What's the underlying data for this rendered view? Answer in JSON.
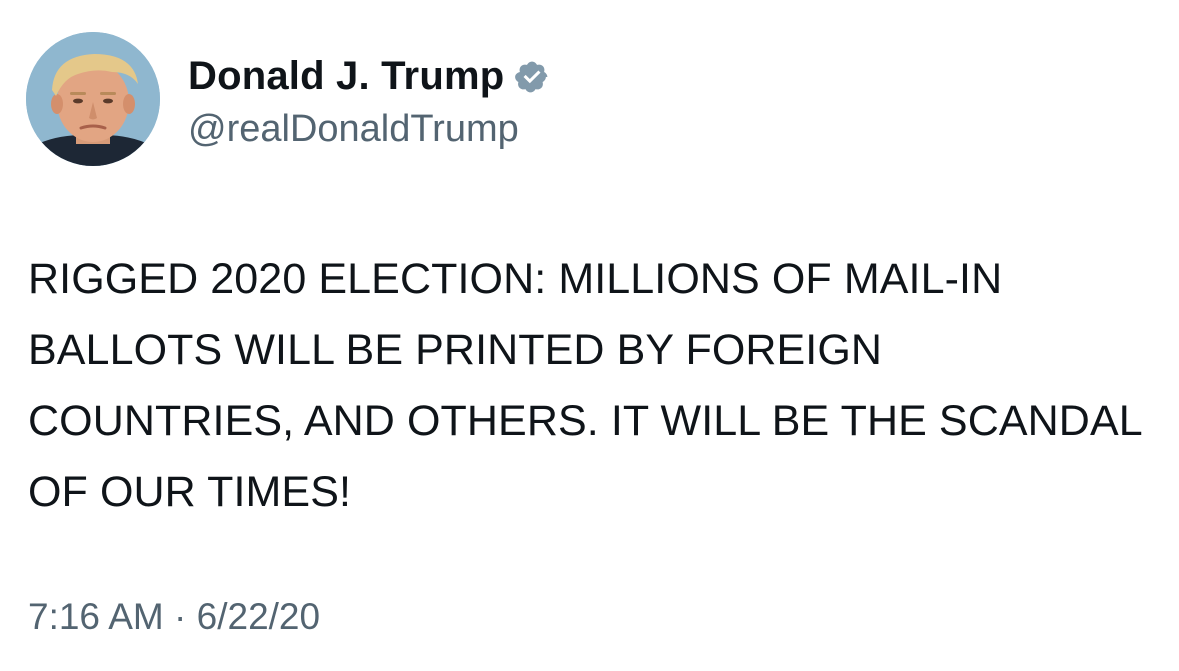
{
  "tweet": {
    "display_name": "Donald J. Trump",
    "handle": "@realDonaldTrump",
    "text": "RIGGED 2020 ELECTION: MILLIONS OF MAIL-IN BALLOTS WILL BE PRINTED BY FOREIGN COUNTRIES, AND OTHERS. IT WILL BE THE SCANDAL OF OUR TIMES!",
    "timestamp": "7:16 AM · 6/22/20",
    "verified_icon": "verified-badge-icon",
    "colors": {
      "text": "#0f1419",
      "secondary": "#536471",
      "badge": "#829aab"
    }
  }
}
